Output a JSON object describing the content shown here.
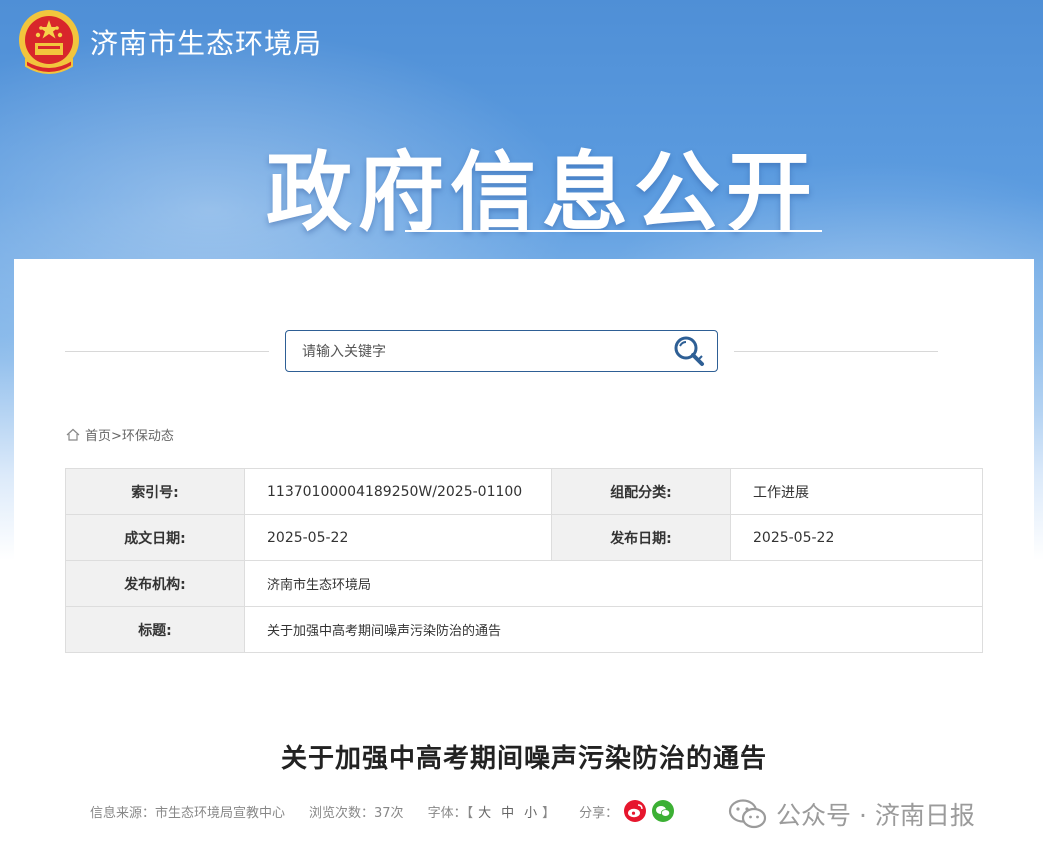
{
  "header": {
    "site_title": "济南市生态环境局",
    "hero_title": "政府信息公开"
  },
  "search": {
    "placeholder": "请输入关键字"
  },
  "breadcrumb": {
    "home": "首页",
    "separator": ">",
    "current": "环保动态"
  },
  "meta_table": {
    "index_label": "索引号:",
    "index_value": "11370100004189250W/2025-01100",
    "category_label": "组配分类:",
    "category_value": "工作进展",
    "created_label": "成文日期:",
    "created_value": "2025-05-22",
    "published_label": "发布日期:",
    "published_value": "2025-05-22",
    "org_label": "发布机构:",
    "org_value": "济南市生态环境局",
    "title_label": "标题:",
    "title_value": "关于加强中高考期间噪声污染防治的通告"
  },
  "article": {
    "title": "关于加强中高考期间噪声污染防治的通告",
    "source": "信息来源：市生态环境局宣教中心",
    "views": "浏览次数：37次",
    "font_label": "字体：",
    "font_open": "【",
    "font_large": "大",
    "font_medium": "中",
    "font_small": "小",
    "font_close": "】",
    "share_label": "分享："
  },
  "watermark": {
    "text": "公众号 · 济南日报"
  },
  "colors": {
    "banner_top": "#4f8fd6",
    "search_border": "#2e5f95",
    "weibo": "#e6162d",
    "wechat": "#3cb034"
  }
}
